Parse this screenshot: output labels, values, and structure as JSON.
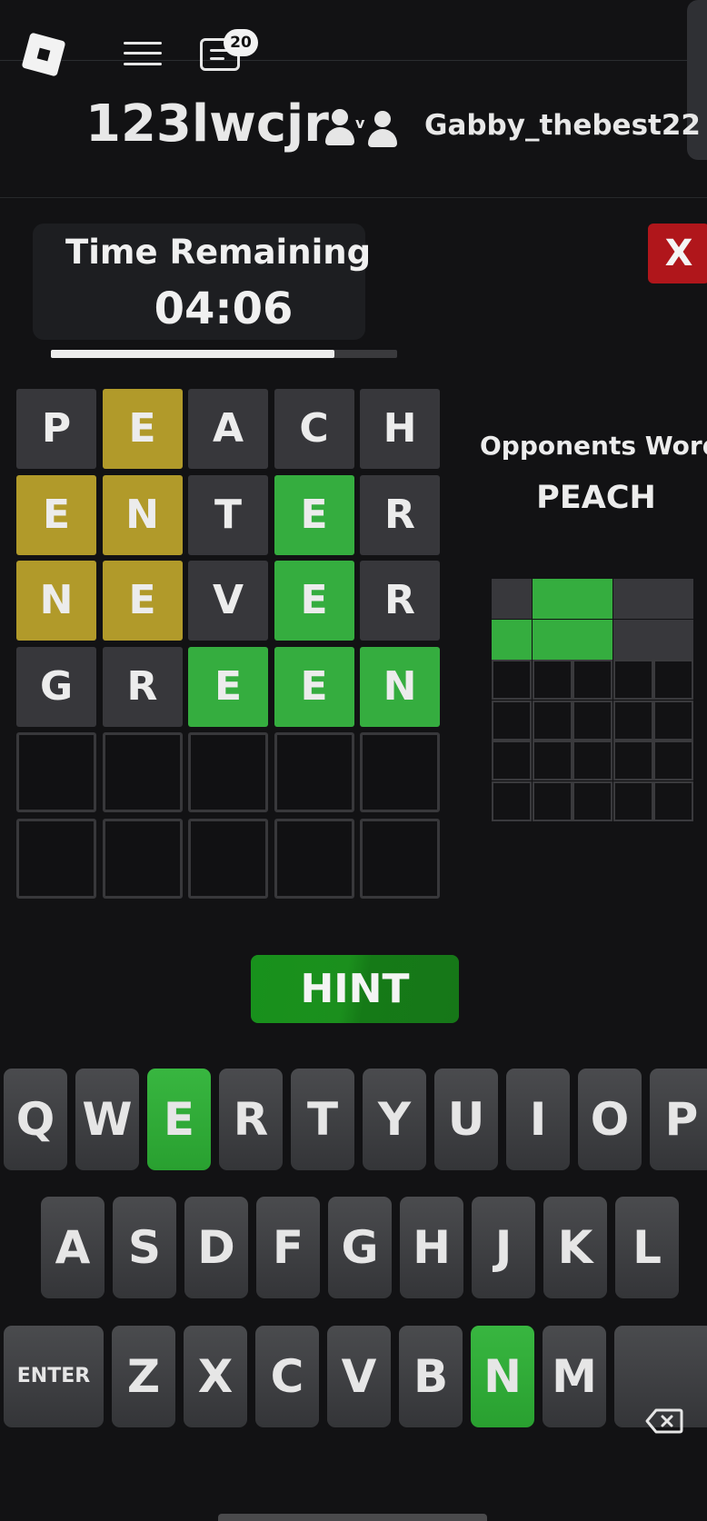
{
  "topbar": {
    "chat_badge_count": "20",
    "icons": [
      "roblox-logo-icon",
      "menu-icon",
      "chat-icon"
    ]
  },
  "players": {
    "player_one": "123lwcjr",
    "player_two": "Gabby_thebest22",
    "versus_icon": "versus-icon"
  },
  "timer": {
    "label": "Time Remaining",
    "value": "04:06",
    "progress_fraction": 0.82
  },
  "close_label": "X",
  "board": {
    "rows": [
      [
        {
          "l": "P",
          "s": "grey"
        },
        {
          "l": "E",
          "s": "yellow"
        },
        {
          "l": "A",
          "s": "grey"
        },
        {
          "l": "C",
          "s": "grey"
        },
        {
          "l": "H",
          "s": "grey"
        }
      ],
      [
        {
          "l": "E",
          "s": "yellow"
        },
        {
          "l": "N",
          "s": "yellow"
        },
        {
          "l": "T",
          "s": "grey"
        },
        {
          "l": "E",
          "s": "green"
        },
        {
          "l": "R",
          "s": "grey"
        }
      ],
      [
        {
          "l": "N",
          "s": "yellow"
        },
        {
          "l": "E",
          "s": "yellow"
        },
        {
          "l": "V",
          "s": "grey"
        },
        {
          "l": "E",
          "s": "green"
        },
        {
          "l": "R",
          "s": "grey"
        }
      ],
      [
        {
          "l": "G",
          "s": "grey"
        },
        {
          "l": "R",
          "s": "grey"
        },
        {
          "l": "E",
          "s": "green"
        },
        {
          "l": "E",
          "s": "green"
        },
        {
          "l": "N",
          "s": "green"
        }
      ],
      [
        {
          "l": "",
          "s": "empty"
        },
        {
          "l": "",
          "s": "empty"
        },
        {
          "l": "",
          "s": "empty"
        },
        {
          "l": "",
          "s": "empty"
        },
        {
          "l": "",
          "s": "empty"
        }
      ],
      [
        {
          "l": "",
          "s": "empty"
        },
        {
          "l": "",
          "s": "empty"
        },
        {
          "l": "",
          "s": "empty"
        },
        {
          "l": "",
          "s": "empty"
        },
        {
          "l": "",
          "s": "empty"
        }
      ]
    ]
  },
  "opponent": {
    "label": "Opponents Word:",
    "word": "PEACH",
    "grid": [
      [
        "d",
        "g",
        "g",
        "d",
        "d"
      ],
      [
        "g",
        "g",
        "g",
        "d",
        "d"
      ],
      [
        "e",
        "e",
        "e",
        "e",
        "e"
      ],
      [
        "e",
        "e",
        "e",
        "e",
        "e"
      ],
      [
        "e",
        "e",
        "e",
        "e",
        "e"
      ],
      [
        "e",
        "e",
        "e",
        "e",
        "e"
      ]
    ]
  },
  "hint_label": "HINT",
  "keyboard": {
    "rows": [
      [
        {
          "k": "Q"
        },
        {
          "k": "W"
        },
        {
          "k": "E",
          "s": "green"
        },
        {
          "k": "R"
        },
        {
          "k": "T"
        },
        {
          "k": "Y"
        },
        {
          "k": "U"
        },
        {
          "k": "I"
        },
        {
          "k": "O"
        },
        {
          "k": "P"
        }
      ],
      [
        {
          "k": "A"
        },
        {
          "k": "S"
        },
        {
          "k": "D"
        },
        {
          "k": "F"
        },
        {
          "k": "G"
        },
        {
          "k": "H"
        },
        {
          "k": "J"
        },
        {
          "k": "K"
        },
        {
          "k": "L"
        }
      ],
      [
        {
          "k": "ENTER",
          "w": "wide"
        },
        {
          "k": "Z"
        },
        {
          "k": "X"
        },
        {
          "k": "C"
        },
        {
          "k": "V"
        },
        {
          "k": "B"
        },
        {
          "k": "N",
          "s": "green"
        },
        {
          "k": "M"
        },
        {
          "k": "",
          "w": "wide",
          "icon": "backspace-icon"
        }
      ]
    ]
  },
  "colors": {
    "background": "#121214",
    "tile_grey": "#37373b",
    "tile_yellow": "#b19a2a",
    "tile_green": "#35ad3f",
    "close_red": "#b0161b",
    "hint_green": "#18911c"
  }
}
